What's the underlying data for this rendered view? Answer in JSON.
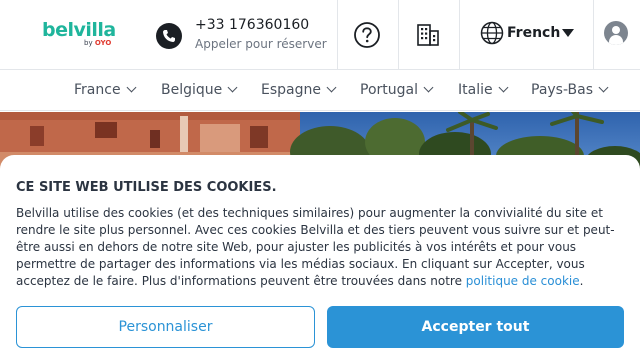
{
  "brand": {
    "name": "belvilla",
    "by_prefix": "by",
    "by_brand": "OYO",
    "primary_color": "#1fb59c",
    "oyo_color": "#e03a2f"
  },
  "header": {
    "phone_number": "+33 176360160",
    "phone_caption": "Appeler pour réserver",
    "help_icon": "question-circle-icon",
    "building_icon": "building-icon",
    "language_label": "French",
    "language_icon": "globe-icon",
    "user_icon": "user-avatar-icon"
  },
  "nav": {
    "items": [
      {
        "label": "France"
      },
      {
        "label": "Belgique"
      },
      {
        "label": "Espagne"
      },
      {
        "label": "Portugal"
      },
      {
        "label": "Italie"
      },
      {
        "label": "Pays-Bas"
      }
    ]
  },
  "cookie_banner": {
    "title": "CE SITE WEB UTILISE DES COOKIES.",
    "body": "Belvilla utilise des cookies (et des techniques similaires) pour augmenter la convivialité du site et rendre le site plus personnel. Avec ces cookies Belvilla et des tiers peuvent vous suivre sur et peut-être aussi en dehors de notre site Web, pour ajuster les publicités à vos intérêts et pour vous permettre de partager des informations via les médias sociaux. En cliquant sur Accepter, vous acceptez de le faire. Plus d'informations peuvent être trouvées dans notre",
    "link_text": "politique de cookie",
    "link_suffix": ".",
    "customize_label": "Personnaliser",
    "accept_label": "Accepter tout",
    "accent_color": "#2b93d6"
  }
}
